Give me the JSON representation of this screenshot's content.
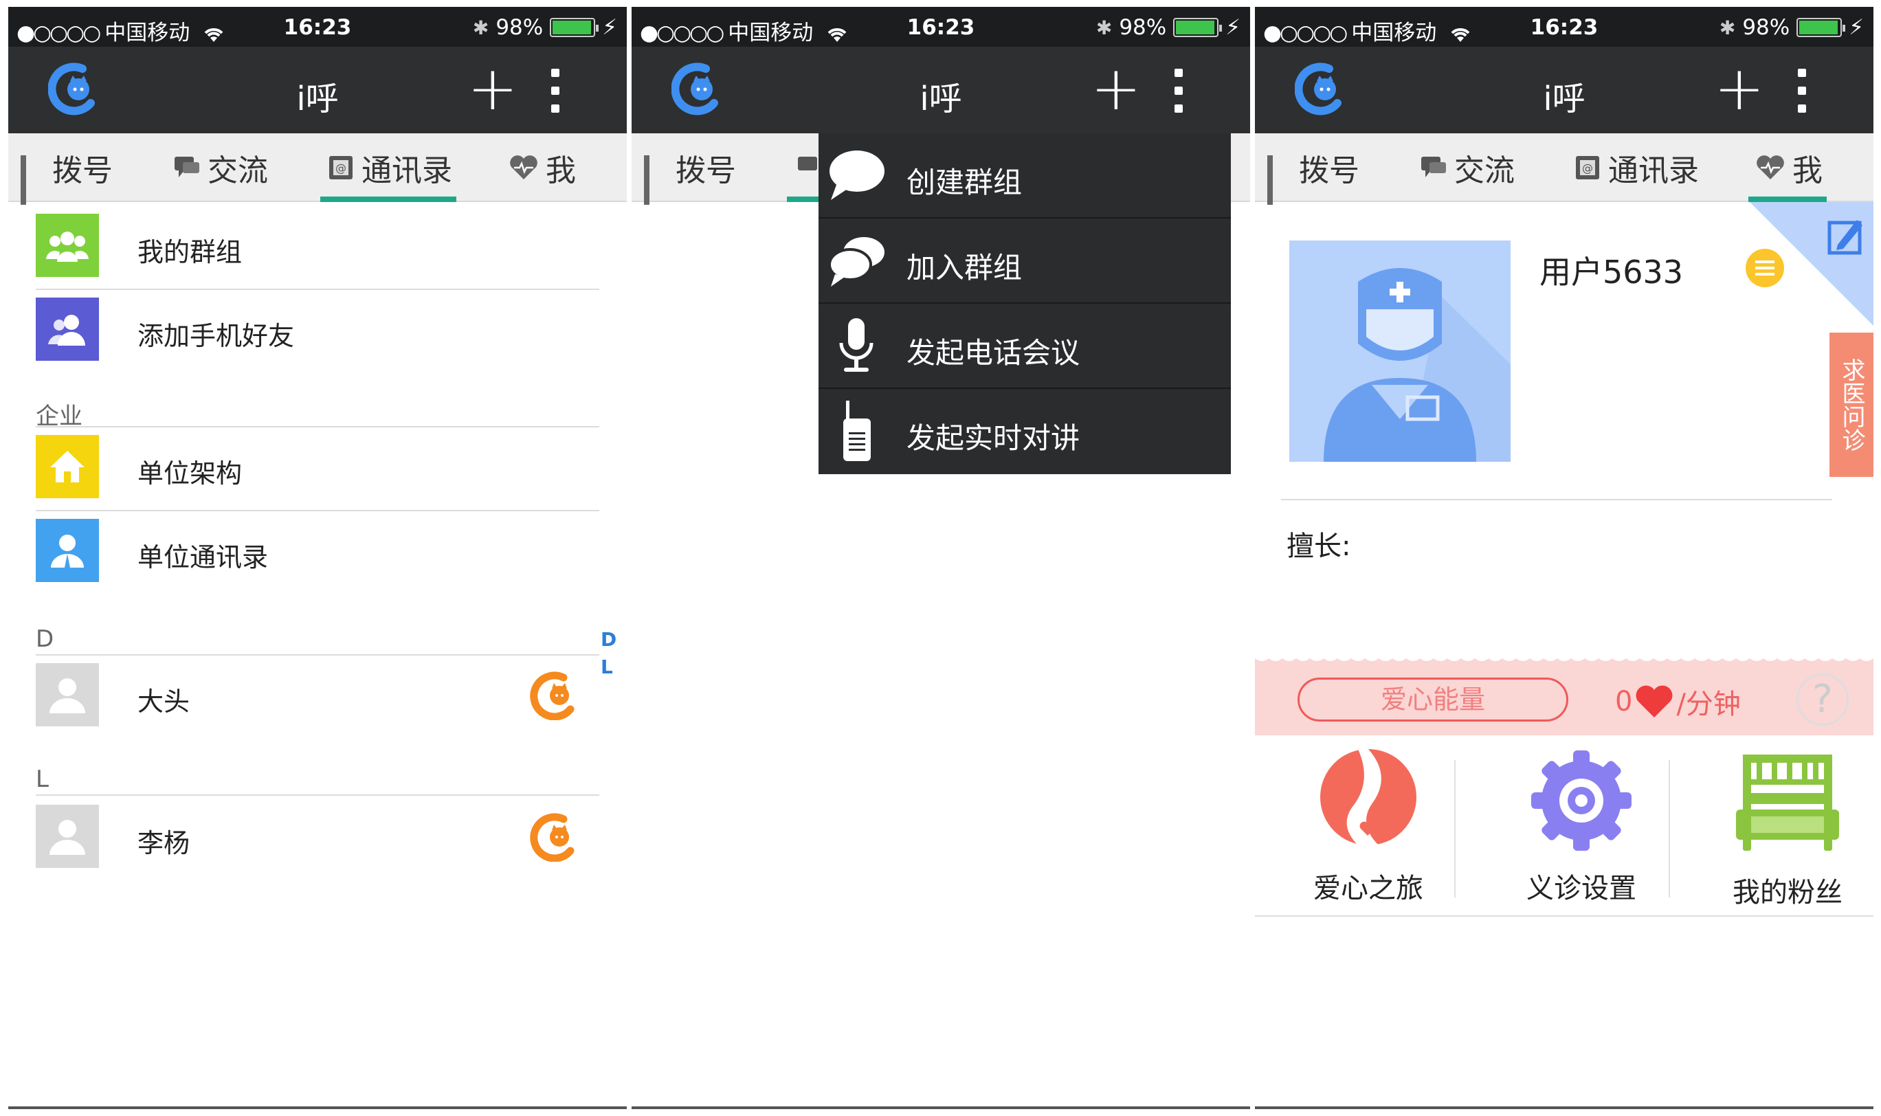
{
  "status_bar": {
    "carrier": "中国移动",
    "time": "16:23",
    "battery": "98%"
  },
  "title_bar": {
    "title": "i呼",
    "add_symbol": "+"
  },
  "tabs": {
    "dial": "拨号",
    "chat": "交流",
    "contacts": "通讯录",
    "me": "我"
  },
  "contacts_list": {
    "items": [
      {
        "label": "我的群组",
        "color": "#7ed13a"
      },
      {
        "label": "添加手机好友",
        "color": "#5b5bd3"
      }
    ],
    "section_enterprise": "企业",
    "enterprise_items": [
      {
        "label": "单位架构",
        "color": "#f5d50d"
      },
      {
        "label": "单位通讯录",
        "color": "#43a2ef"
      }
    ],
    "section_d": "D",
    "contact_d": "大头",
    "section_l": "L",
    "contact_l": "李杨",
    "index_letters": [
      "D",
      "L"
    ]
  },
  "popup_menu": {
    "items": [
      {
        "label": "创建群组",
        "icon": "speech-bubble-icon"
      },
      {
        "label": "加入群组",
        "icon": "double-speech-bubble-icon"
      },
      {
        "label": "发起电话会议",
        "icon": "microphone-icon"
      },
      {
        "label": "发起实时对讲",
        "icon": "walkie-talkie-icon"
      }
    ]
  },
  "profile": {
    "username": "用户5633",
    "side_tag": "求医问诊",
    "specialty_label": "擅长:",
    "love_energy_label": "爱心能量",
    "love_count": "0",
    "love_unit": "/分钟",
    "help_symbol": "?",
    "features": [
      {
        "label": "爱心之旅"
      },
      {
        "label": "义诊设置"
      },
      {
        "label": "我的粉丝"
      }
    ]
  },
  "colors": {
    "accent": "#1ea889",
    "title_bar": "#2d2f31",
    "status_bar": "#1b1d1f",
    "love": "#ee5a5a",
    "photo_bg": "#b7d2fb"
  }
}
